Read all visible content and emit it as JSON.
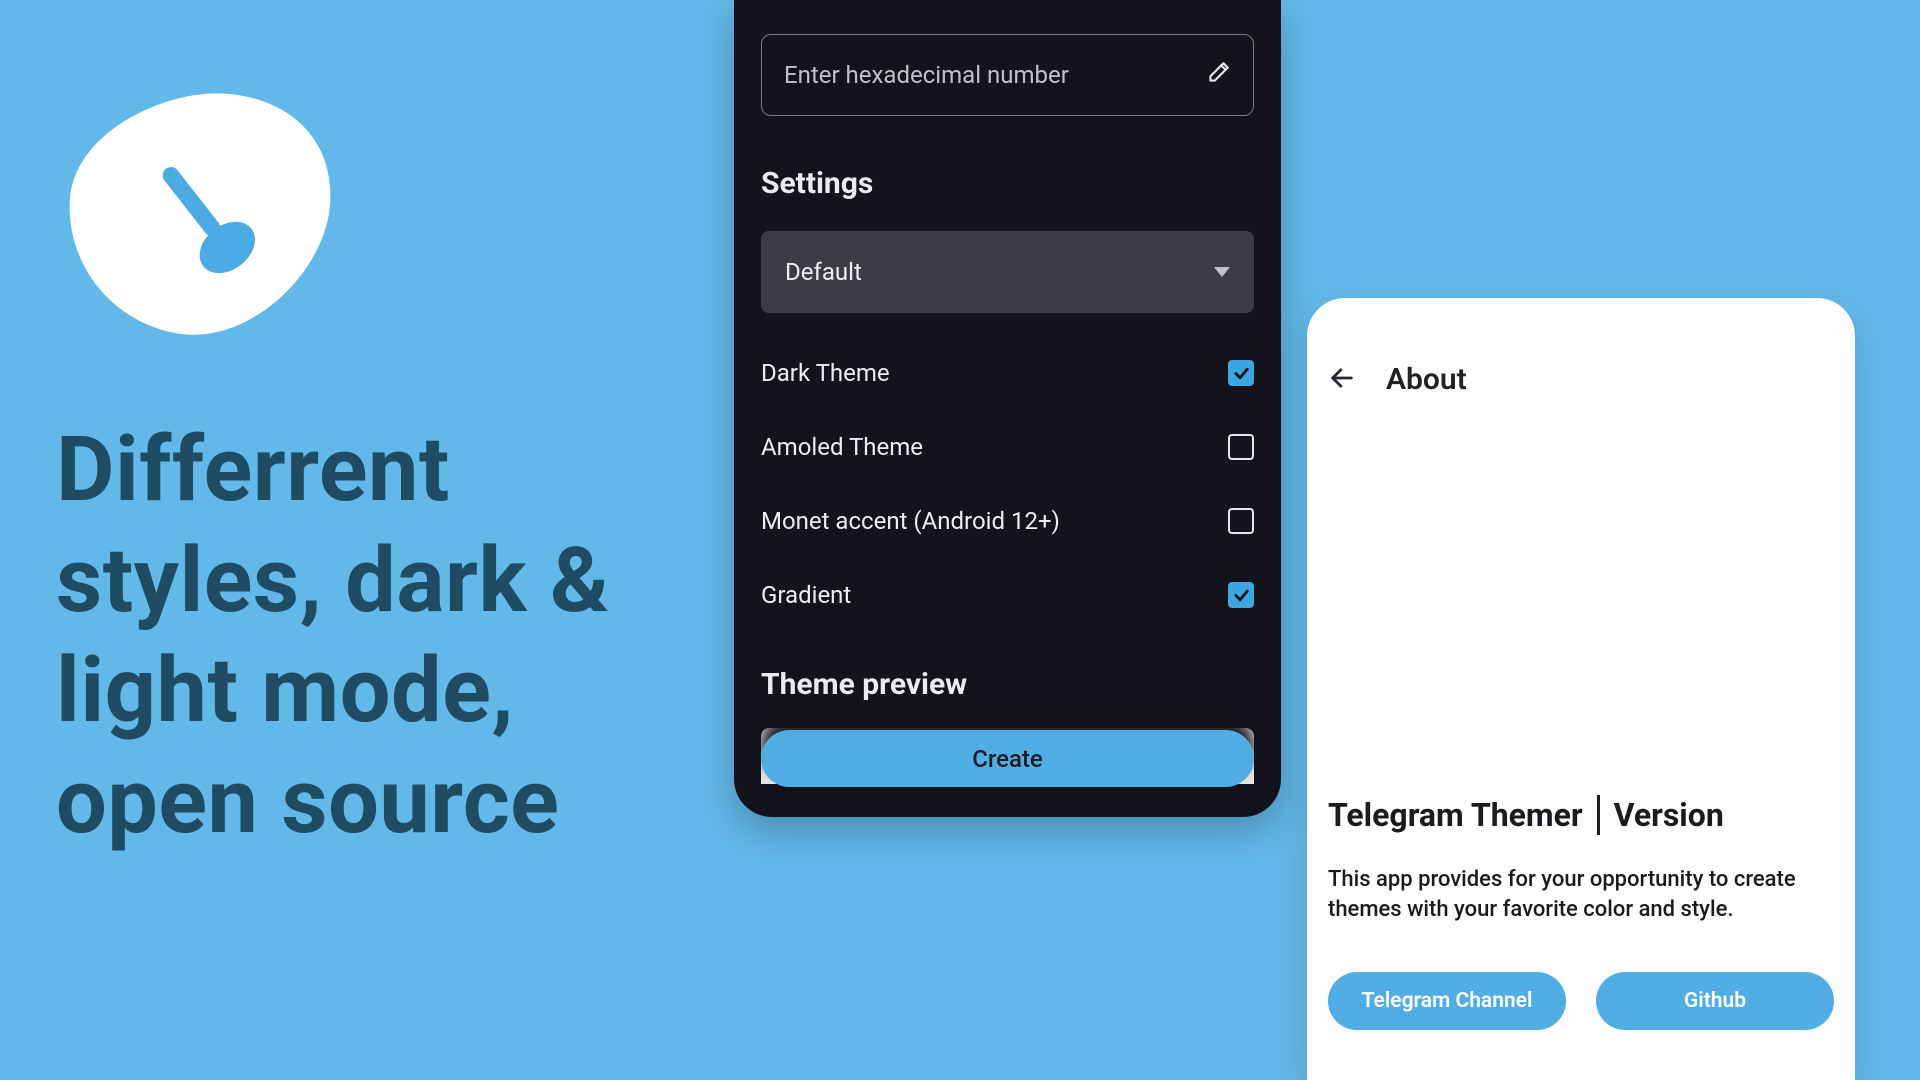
{
  "accent": "#51AEE4",
  "bg": "#62B8E8",
  "headline": "Differrent styles, dark & light mode, open source",
  "dark_panel": {
    "hex_placeholder": "Enter hexadecimal number",
    "settings_title": "Settings",
    "dropdown_value": "Default",
    "options": [
      {
        "label": "Dark Theme",
        "checked": true
      },
      {
        "label": "Amoled Theme",
        "checked": false
      },
      {
        "label": "Monet accent (Android 12+)",
        "checked": false
      },
      {
        "label": "Gradient",
        "checked": true
      }
    ],
    "preview_title": "Theme preview",
    "create_label": "Create"
  },
  "light_panel": {
    "title": "About",
    "app_name": "Telegram Themer",
    "version_label": "Version",
    "description": "This app provides for your opportunity to create themes with your favorite color and style.",
    "btn_channel": "Telegram Channel",
    "btn_github": "Github"
  }
}
